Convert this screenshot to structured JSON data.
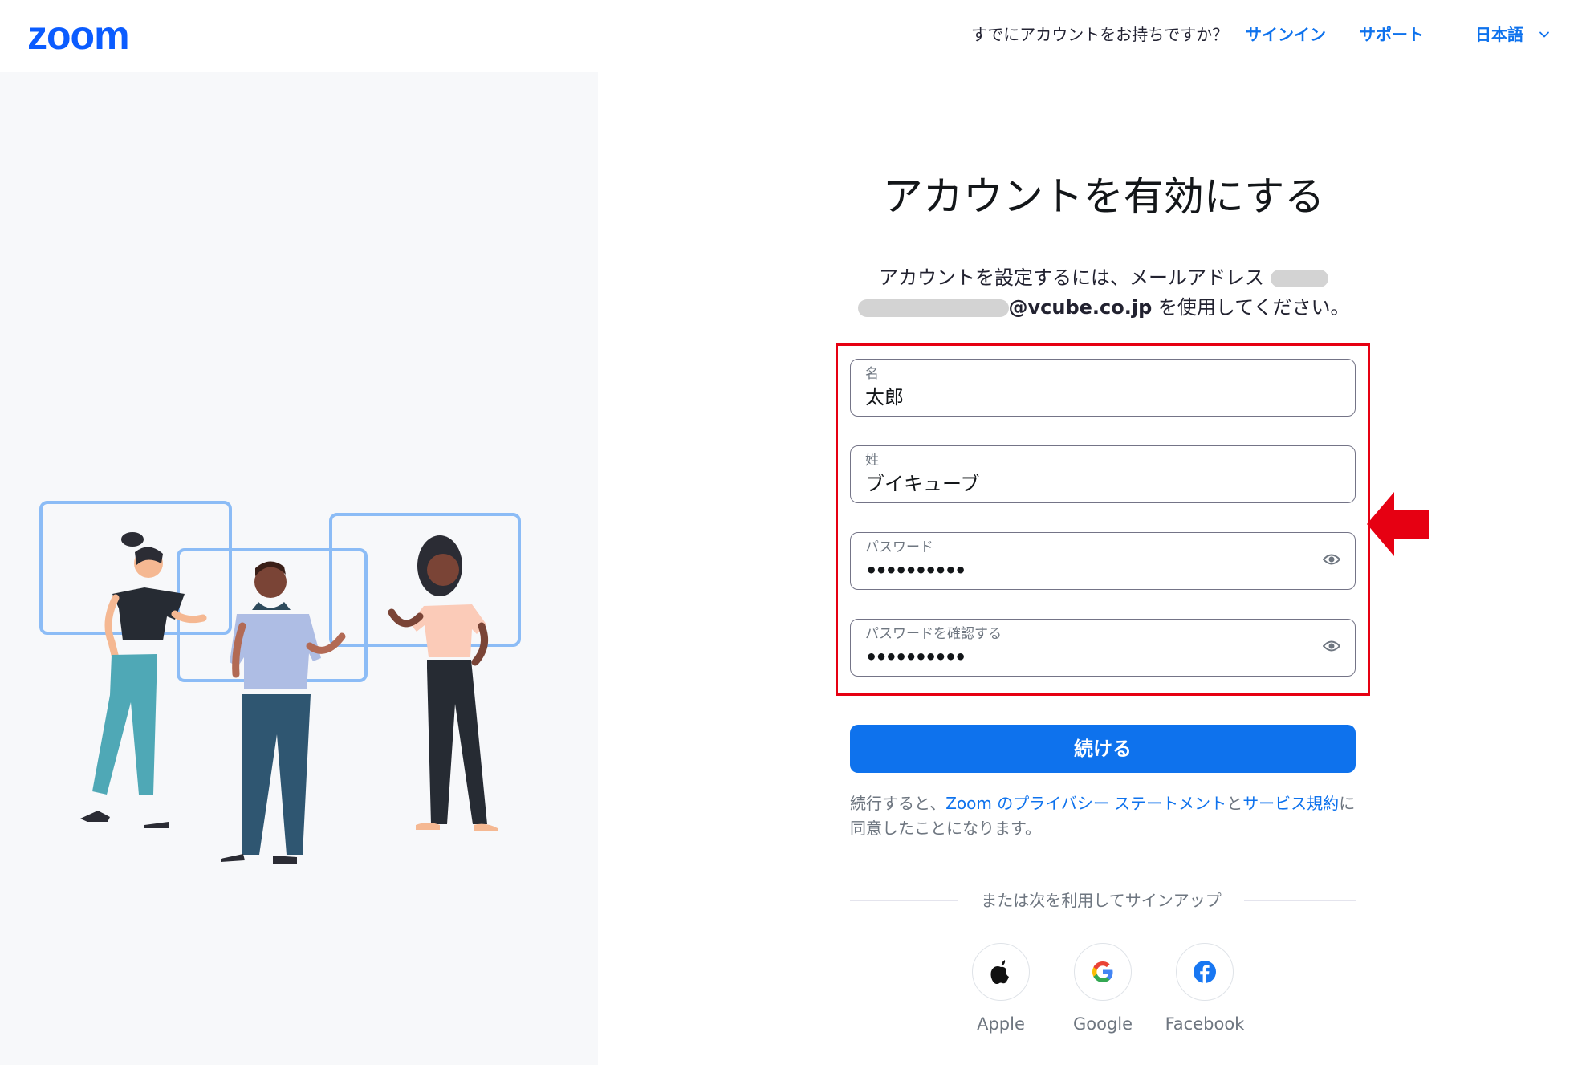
{
  "header": {
    "logo": "zoom",
    "question": "すでにアカウントをお持ちですか？",
    "signin": "サインイン",
    "support": "サポート",
    "language": "日本語"
  },
  "page": {
    "title": "アカウントを有効にする",
    "subtitle_prefix": "アカウントを設定するには、メールアドレス",
    "email_visible": "@vcube.co.jp",
    "subtitle_suffix": " を使用してください。"
  },
  "form": {
    "first_name": {
      "label": "名",
      "value": "太郎"
    },
    "last_name": {
      "label": "姓",
      "value": "ブイキューブ"
    },
    "password": {
      "label": "パスワード",
      "value": "••••••••••"
    },
    "confirm_password": {
      "label": "パスワードを確認する",
      "value": "••••••••••"
    },
    "continue_label": "続ける"
  },
  "terms": {
    "prefix": "続行すると、",
    "privacy_link": "Zoom のプライバシー ステートメント",
    "and": "と",
    "tos_link": "サービス規約",
    "suffix": "に同意したことになります。"
  },
  "social": {
    "divider": "または次を利用してサインアップ",
    "apple": "Apple",
    "google": "Google",
    "facebook": "Facebook"
  },
  "colors": {
    "brand_blue": "#0b5cff",
    "link_blue": "#0e72ed",
    "highlight_red": "#e60012"
  }
}
